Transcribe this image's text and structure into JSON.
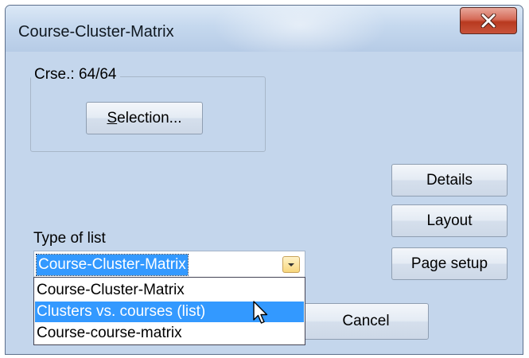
{
  "window": {
    "title": "Course-Cluster-Matrix"
  },
  "group": {
    "label": "Crse.: 64/64",
    "selection_button": {
      "mnemonic": "S",
      "rest": "election..."
    }
  },
  "buttons": {
    "details": "Details",
    "layout": "Layout",
    "page_setup": "Page setup",
    "cancel": "Cancel"
  },
  "list_type": {
    "label": "Type of list",
    "selected": "Course-Cluster-Matrix",
    "options": [
      "Course-Cluster-Matrix",
      "Clusters vs. courses (list)",
      "Course-course-matrix"
    ],
    "highlighted_index": 1
  },
  "icons": {
    "close": "close-x-icon",
    "dropdown": "dropdown-arrow-icon",
    "cursor": "mouse-pointer-icon"
  },
  "colors": {
    "dialog_bg": "#c4d6ec",
    "selection": "#3399ff",
    "close_button": "#c8533b"
  }
}
